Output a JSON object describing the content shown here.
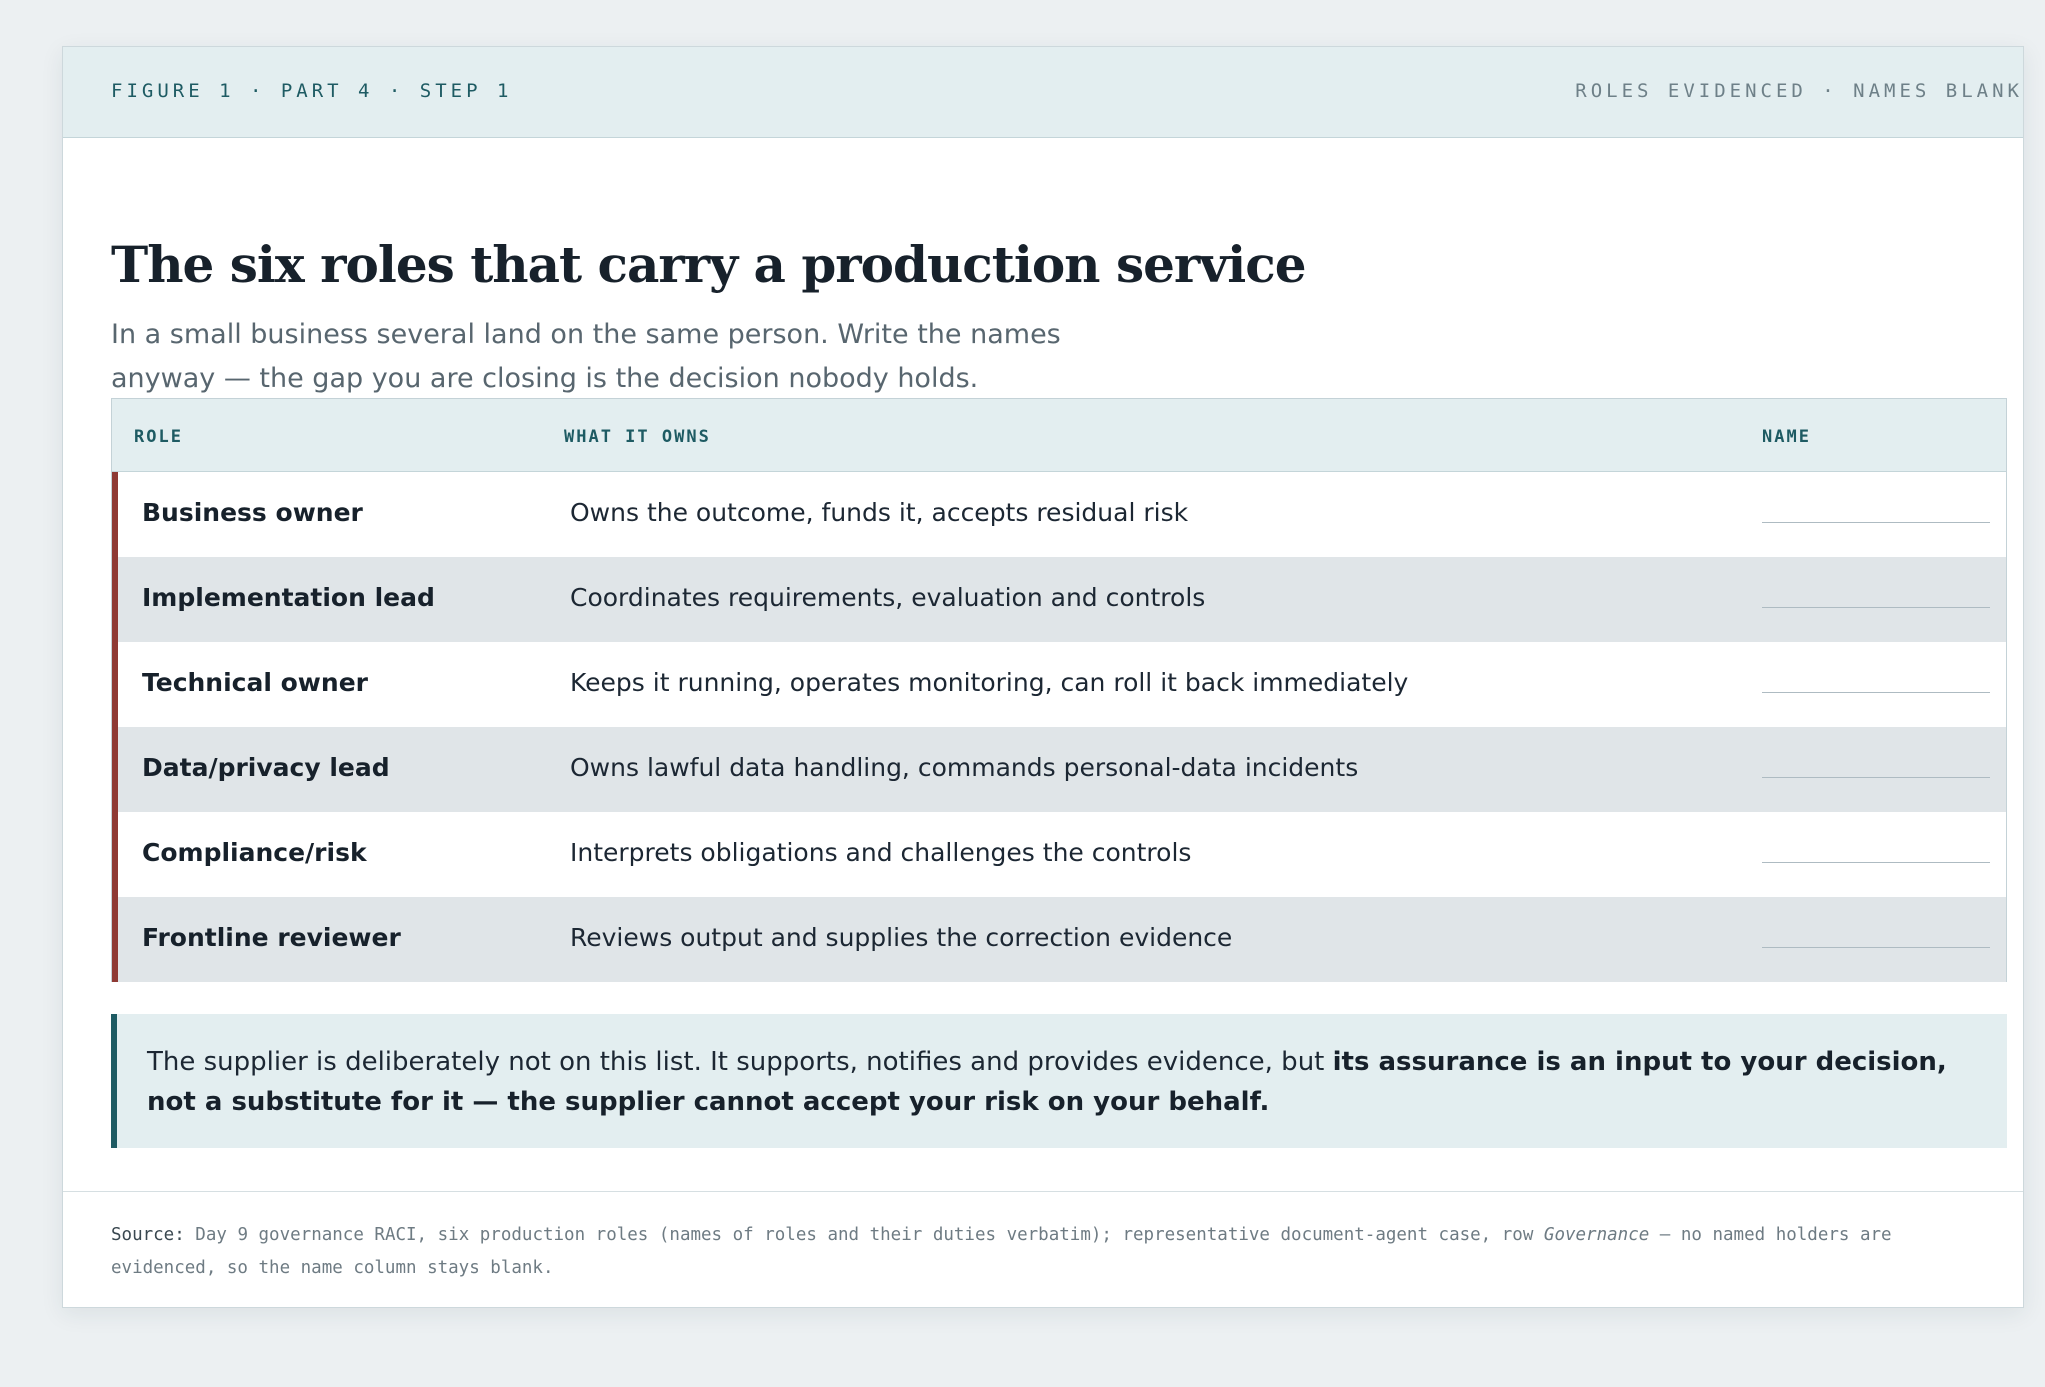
{
  "header": {
    "figure_label": "FIGURE 1 · PART 4 · STEP 1",
    "status_label": "ROLES EVIDENCED · NAMES BLANK"
  },
  "title": "The six roles that carry a production service",
  "subtitle": "In a small business several land on the same person. Write the names anyway — the gap you are closing is the decision nobody holds.",
  "table": {
    "headers": {
      "role": "ROLE",
      "owns": "WHAT IT OWNS",
      "name": "NAME"
    },
    "rows": [
      {
        "role": "Business owner",
        "owns": "Owns the outcome, funds it, accepts residual risk",
        "name": ""
      },
      {
        "role": "Implementation lead",
        "owns": "Coordinates requirements, evaluation and controls",
        "name": ""
      },
      {
        "role": "Technical owner",
        "owns": "Keeps it running, operates monitoring, can roll it back immediately",
        "name": ""
      },
      {
        "role": "Data/privacy lead",
        "owns": "Owns lawful data handling, commands personal-data incidents",
        "name": ""
      },
      {
        "role": "Compliance/risk",
        "owns": "Interprets obligations and challenges the controls",
        "name": ""
      },
      {
        "role": "Frontline reviewer",
        "owns": "Reviews output and supplies the correction evidence",
        "name": ""
      }
    ]
  },
  "callout": {
    "text": "The supplier is deliberately not on this list. It supports, notifies and provides evidence, but ",
    "emphasis": "its assurance is an input to your decision, not a substitute for it — the supplier cannot accept your risk on your behalf."
  },
  "source": {
    "label": "Source:",
    "text_before": " Day 9 governance RACI, six production roles (names of roles and their duties verbatim); representative document-agent case, row ",
    "italic": "Governance",
    "text_after": " — no named holders are evidenced, so the name column stays blank."
  },
  "colors": {
    "accent_teal": "#1e5b63",
    "row_marker_red": "#8f3a34",
    "header_band": "#e3eef0",
    "alt_row": "#e0e5e8"
  }
}
